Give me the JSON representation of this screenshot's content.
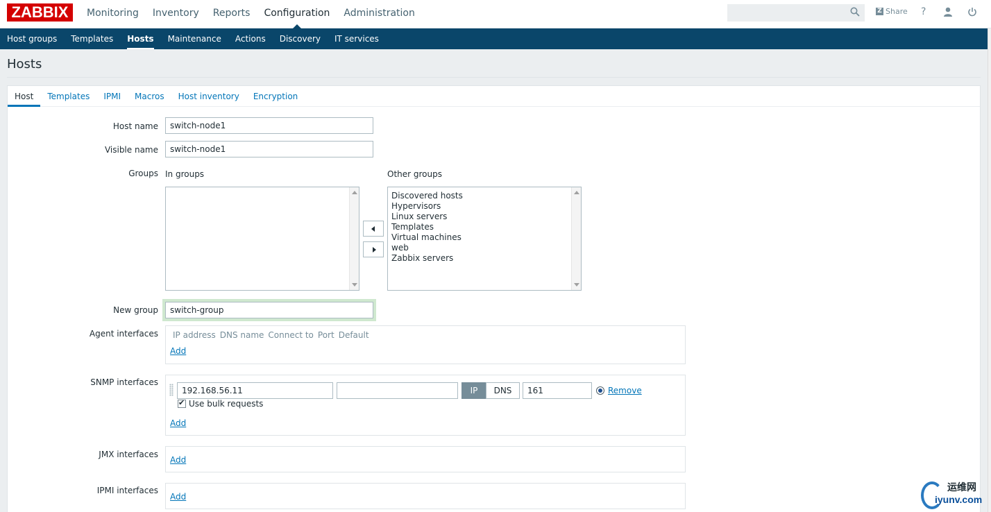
{
  "logo": "ZABBIX",
  "top_menu": [
    "Monitoring",
    "Inventory",
    "Reports",
    "Configuration",
    "Administration"
  ],
  "top_menu_selected": "Configuration",
  "header_right": {
    "share": "Share",
    "help": "?"
  },
  "sub_menu": [
    "Host groups",
    "Templates",
    "Hosts",
    "Maintenance",
    "Actions",
    "Discovery",
    "IT services"
  ],
  "sub_menu_selected": "Hosts",
  "page_title": "Hosts",
  "tabs": [
    "Host",
    "Templates",
    "IPMI",
    "Macros",
    "Host inventory",
    "Encryption"
  ],
  "form": {
    "host_name_label": "Host name",
    "host_name_value": "switch-node1",
    "visible_name_label": "Visible name",
    "visible_name_value": "switch-node1",
    "groups_label": "Groups",
    "in_groups_label": "In groups",
    "other_groups_label": "Other groups",
    "other_groups": [
      "Discovered hosts",
      "Hypervisors",
      "Linux servers",
      "Templates",
      "Virtual machines",
      "web",
      "Zabbix servers"
    ],
    "new_group_label": "New group",
    "new_group_value": "switch-group",
    "agent_label": "Agent interfaces",
    "agent_headers": [
      "IP address",
      "DNS name",
      "Connect to",
      "Port",
      "Default"
    ],
    "add": "Add",
    "snmp_label": "SNMP interfaces",
    "snmp_ip": "192.168.56.11",
    "snmp_dns": "",
    "connect_ip": "IP",
    "connect_dns": "DNS",
    "snmp_port": "161",
    "remove": "Remove",
    "bulk_label": "Use bulk requests",
    "jmx_label": "JMX interfaces",
    "ipmi_label": "IPMI interfaces"
  },
  "watermark": {
    "cn": "运维网",
    "en": "iyunv.com"
  },
  "colors": {
    "brand": "#d40000",
    "nav": "#0a466a",
    "link": "#0275b8"
  }
}
